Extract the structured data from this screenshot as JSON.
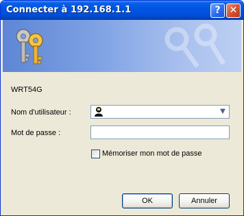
{
  "window": {
    "title": "Connecter à 192.168.1.1",
    "help_label": "?",
    "close_label": "✕"
  },
  "dialog": {
    "server_name": "WRT54G",
    "username_label": "Nom d'utilisateur :",
    "username_value": "",
    "password_label": "Mot de passe :",
    "password_value": "",
    "remember_label": "Mémoriser mon mot de passe",
    "remember_checked": false
  },
  "buttons": {
    "ok": "OK",
    "cancel": "Annuler"
  },
  "icons": {
    "banner": "keys-icon",
    "user": "user-icon",
    "dropdown": "chevron-down-icon"
  },
  "colors": {
    "titlebar": "#0054e3",
    "window_bg": "#ece9d8",
    "banner_left": "#5e86d6",
    "banner_right": "#bccff3",
    "field_border": "#7f9db9"
  }
}
